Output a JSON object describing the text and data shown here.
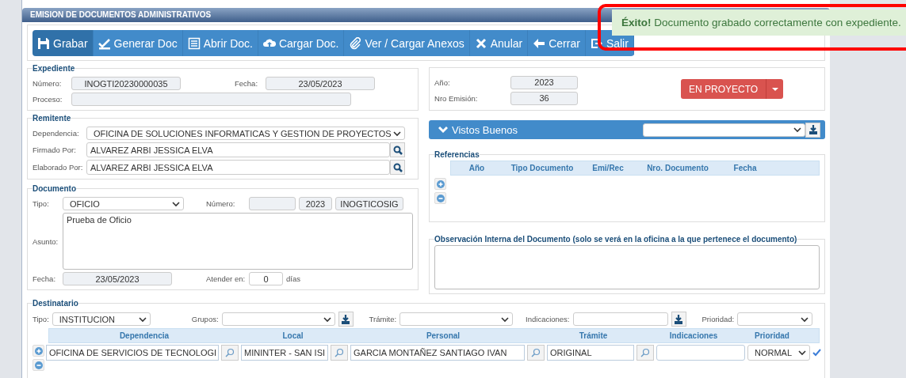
{
  "panel": {
    "title": "EMISION DE DOCUMENTOS ADMINISTRATIVOS"
  },
  "toolbar": [
    {
      "label": "Grabar",
      "selected": true
    },
    {
      "label": "Generar Doc",
      "selected": false
    },
    {
      "label": "Abrir Doc.",
      "selected": false
    },
    {
      "label": "Cargar Doc.",
      "selected": false
    },
    {
      "label": "Ver / Cargar Anexos",
      "selected": false
    },
    {
      "label": "Anular",
      "selected": false
    },
    {
      "label": "Cerrar",
      "selected": false
    },
    {
      "label": "Salir",
      "selected": false
    }
  ],
  "notification": {
    "kind": "success",
    "message": "**Éxito!** Documento grabado correctamente con expediente."
  },
  "highlight_frame": true,
  "expediente": {
    "title": "Expediente",
    "numero": {
      "label": "Número:",
      "value": "INOGTI20230000035"
    },
    "fecha": {
      "label": "Fecha:",
      "value": "23/05/2023"
    },
    "proceso": {
      "label": "Proceso:"
    }
  },
  "emision": {
    "anio": {
      "label": "Año:",
      "value": "2023"
    },
    "nro": {
      "label": "Nro Emisión:",
      "value": "36"
    },
    "estado": {
      "label": "EN PROYECTO"
    }
  },
  "remitente": {
    "title": "Remitente",
    "dependencia": {
      "label": "Dependencia:",
      "value": "OFICINA DE SOLUCIONES INFORMATICAS Y GESTION DE PROYECTOS"
    },
    "firmado": {
      "label": "Firmado Por:",
      "value": "ALVAREZ ARBI JESSICA ELVA"
    },
    "elaborado": {
      "label": "Elaborado Por:",
      "value": "ALVAREZ ARBI JESSICA ELVA"
    }
  },
  "documento": {
    "title": "Documento",
    "tipo": {
      "label": "Tipo:",
      "value": "OFICIO"
    },
    "numero": {
      "label": "Número:",
      "year": "2023",
      "code": "INOGTICOSIG"
    },
    "asunto": {
      "label": "Asunto:",
      "value": "Prueba de Oficio"
    },
    "fecha": {
      "label": "Fecha:",
      "value": "23/05/2023"
    },
    "atender": {
      "label": "Atender en:",
      "value": "0",
      "unit": "días"
    }
  },
  "vistos_buenos": {
    "title": "Vistos Buenos",
    "expanded": true
  },
  "referencias": {
    "title": "Referencias",
    "columns": [
      "Año",
      "Tipo Documento",
      "Emi/Rec",
      "Nro. Documento",
      "Fecha"
    ]
  },
  "observacion": {
    "title": "Observación Interna del Documento (solo se verá en la oficina a la que pertenece el documento)"
  },
  "destinatario": {
    "title": "Destinatario",
    "tipo": {
      "label": "Tipo:",
      "value": "INSTITUCION"
    },
    "grupos": {
      "label": "Grupos:"
    },
    "tramite": {
      "label": "Trámite:"
    },
    "indicaciones": {
      "label": "Indicaciones:"
    },
    "prioridad": {
      "label": "Prioridad:"
    },
    "columns": [
      "Dependencia",
      "Local",
      "Personal",
      "Trámite",
      "Indicaciones",
      "Prioridad"
    ],
    "rows": [
      {
        "dependencia": "OFICINA DE SERVICIOS DE TECNOLOGI",
        "local": "MININTER - SAN ISI",
        "personal": "GARCIA MONTAÑEZ SANTIAGO IVAN",
        "tramite": "ORIGINAL",
        "prioridad": "NORMAL",
        "checked": true
      }
    ]
  }
}
